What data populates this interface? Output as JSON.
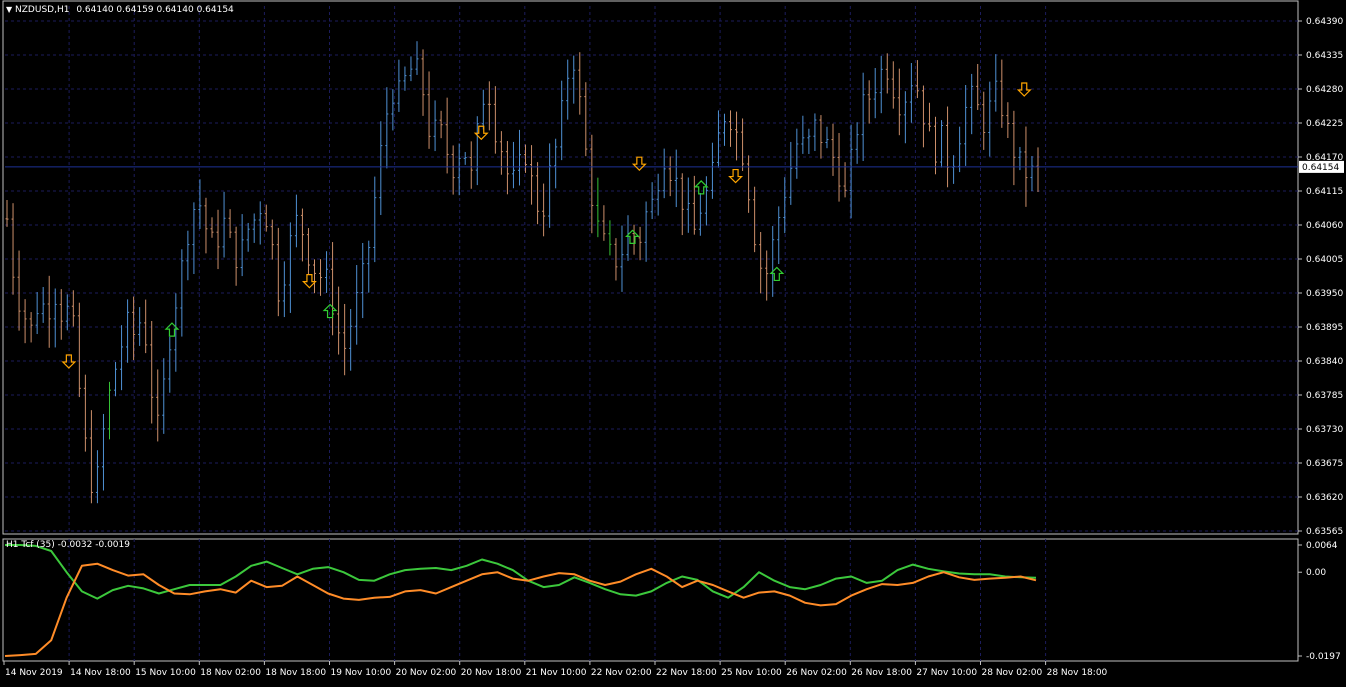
{
  "header": {
    "symbol": "NZDUSD,H1",
    "ohlc": "0.64140 0.64159 0.64140 0.64154"
  },
  "indicator": {
    "label": "H1 Tcf (35) -0.0032 -0.0019"
  },
  "colors": {
    "background": "#000000",
    "grid": "#1c1c5c",
    "frame": "#c0c0c0",
    "bull_bar": "#4f91d4",
    "bear_bar": "#cc8f6a",
    "green_bar": "#36c236",
    "up_arrow": "#32cd32",
    "down_arrow": "#ffa500",
    "tcf_green": "#3cc83c",
    "tcf_orange": "#ff8c28",
    "price_line": "#1e3296",
    "price_tag_bg": "#ffffff",
    "price_tag_text": "#000000"
  },
  "chart_data": [
    {
      "type": "ohlc",
      "title": "NZDUSD,H1",
      "timeframe": "H1",
      "ylim": [
        0.63565,
        0.6439
      ],
      "y_ticks": [
        "0.64390",
        "0.64335",
        "0.64280",
        "0.64225",
        "0.64170",
        "0.64115",
        "0.64060",
        "0.64005",
        "0.63950",
        "0.63895",
        "0.63840",
        "0.63785",
        "0.63730",
        "0.63675",
        "0.63620",
        "0.63565"
      ],
      "x_ticks": [
        "14 Nov 2019",
        "14 Nov 18:00",
        "15 Nov 10:00",
        "18 Nov 02:00",
        "18 Nov 18:00",
        "19 Nov 10:00",
        "20 Nov 02:00",
        "20 Nov 18:00",
        "21 Nov 10:00",
        "22 Nov 02:00",
        "22 Nov 18:00",
        "25 Nov 10:00",
        "26 Nov 02:00",
        "26 Nov 18:00",
        "27 Nov 10:00",
        "28 Nov 02:00",
        "28 Nov 18:00"
      ],
      "current_price": "0.64154",
      "close_path": [
        0.6407,
        0.6396,
        0.6392,
        0.6389,
        0.6394,
        0.6392,
        0.6395,
        0.6391,
        0.6393,
        0.638,
        0.6368,
        0.6362,
        0.6372,
        0.638,
        0.6385,
        0.639,
        0.6388,
        0.6392,
        0.638,
        0.6372,
        0.6385,
        0.6393,
        0.64,
        0.6408,
        0.641,
        0.6405,
        0.6402,
        0.6407,
        0.6403,
        0.64,
        0.6405,
        0.6407,
        0.641,
        0.6404,
        0.6395,
        0.64,
        0.6407,
        0.6405,
        0.64,
        0.6398,
        0.6397,
        0.6392,
        0.6385,
        0.639,
        0.6395,
        0.64,
        0.641,
        0.642,
        0.6428,
        0.6427,
        0.643,
        0.6432,
        0.6428,
        0.642,
        0.6422,
        0.6418,
        0.6415,
        0.642,
        0.6413,
        0.6422,
        0.643,
        0.6422,
        0.6418,
        0.6412,
        0.6415,
        0.6418,
        0.641,
        0.6408,
        0.6415,
        0.642,
        0.643,
        0.6433,
        0.6422,
        0.6412,
        0.6405,
        0.6402,
        0.64,
        0.6402,
        0.6405,
        0.6403,
        0.6408,
        0.641,
        0.6418,
        0.6415,
        0.6412,
        0.6408,
        0.6405,
        0.641,
        0.6412,
        0.642,
        0.6425,
        0.6422,
        0.6418,
        0.641,
        0.64,
        0.6398,
        0.6404,
        0.641,
        0.6415,
        0.642,
        0.6418,
        0.6422,
        0.642,
        0.6418,
        0.6415,
        0.641,
        0.642,
        0.6425,
        0.6427,
        0.643,
        0.6432,
        0.6428,
        0.6425,
        0.643,
        0.6428,
        0.6422,
        0.6418,
        0.642,
        0.6415,
        0.642,
        0.6425,
        0.6427,
        0.6422,
        0.6425,
        0.6428,
        0.6422,
        0.6418,
        0.6415,
        0.6414,
        0.64154
      ],
      "signals": [
        {
          "direction": "down",
          "time_index": 9,
          "price": 0.6384
        },
        {
          "direction": "up",
          "time_index": 24,
          "price": 0.6389
        },
        {
          "direction": "down",
          "time_index": 44,
          "price": 0.6397
        },
        {
          "direction": "up",
          "time_index": 47,
          "price": 0.6392
        },
        {
          "direction": "down",
          "time_index": 69,
          "price": 0.6421
        },
        {
          "direction": "down",
          "time_index": 92,
          "price": 0.6416
        },
        {
          "direction": "up",
          "time_index": 91,
          "price": 0.6404
        },
        {
          "direction": "up",
          "time_index": 101,
          "price": 0.6412
        },
        {
          "direction": "down",
          "time_index": 106,
          "price": 0.6414
        },
        {
          "direction": "up",
          "time_index": 112,
          "price": 0.6398
        },
        {
          "direction": "down",
          "time_index": 148,
          "price": 0.6428
        }
      ]
    },
    {
      "type": "line",
      "title": "H1 Tcf (35)",
      "ylim": [
        -0.0197,
        0.0064
      ],
      "y_ticks": [
        "0.0064",
        "0.00",
        "-0.0197"
      ],
      "series": [
        {
          "color": "green",
          "values": [
            0.0064,
            0.0064,
            0.0062,
            0.005,
            0.0,
            -0.0045,
            -0.0062,
            -0.0042,
            -0.0032,
            -0.0038,
            -0.005,
            -0.004,
            -0.003,
            -0.003,
            -0.003,
            -0.001,
            0.0015,
            0.0025,
            0.001,
            -0.0005,
            0.0008,
            0.0012,
            0.0,
            -0.0018,
            -0.002,
            -0.0005,
            0.0005,
            0.0008,
            0.001,
            0.0005,
            0.0015,
            0.003,
            0.002,
            0.0005,
            -0.002,
            -0.0035,
            -0.003,
            -0.0012,
            -0.0025,
            -0.004,
            -0.0052,
            -0.0055,
            -0.0045,
            -0.0025,
            -0.001,
            -0.0018,
            -0.0045,
            -0.006,
            -0.0035,
            0.0,
            -0.002,
            -0.0035,
            -0.004,
            -0.003,
            -0.0015,
            -0.001,
            -0.0025,
            -0.002,
            0.0005,
            0.0018,
            0.0008,
            0.0002,
            -0.0003,
            -0.0005,
            -0.0005,
            -0.001,
            -0.0012,
            -0.0013
          ]
        },
        {
          "color": "orange",
          "values": [
            -0.0197,
            -0.0195,
            -0.0192,
            -0.016,
            -0.006,
            0.0015,
            0.002,
            0.0005,
            -0.0008,
            -0.0005,
            -0.003,
            -0.005,
            -0.0052,
            -0.0045,
            -0.004,
            -0.0048,
            -0.002,
            -0.0035,
            -0.0032,
            -0.001,
            -0.003,
            -0.005,
            -0.0062,
            -0.0065,
            -0.006,
            -0.0058,
            -0.0045,
            -0.0042,
            -0.005,
            -0.0035,
            -0.002,
            -0.0005,
            0.0,
            -0.0015,
            -0.002,
            -0.001,
            -0.0002,
            -0.0005,
            -0.002,
            -0.003,
            -0.0022,
            -0.0005,
            0.0008,
            -0.001,
            -0.0035,
            -0.002,
            -0.003,
            -0.0045,
            -0.006,
            -0.0048,
            -0.0045,
            -0.0055,
            -0.0072,
            -0.0078,
            -0.0075,
            -0.0055,
            -0.004,
            -0.0028,
            -0.003,
            -0.0025,
            -0.001,
            0.0,
            -0.0012,
            -0.0018,
            -0.0015,
            -0.0013,
            -0.001,
            -0.0019
          ]
        }
      ]
    }
  ]
}
